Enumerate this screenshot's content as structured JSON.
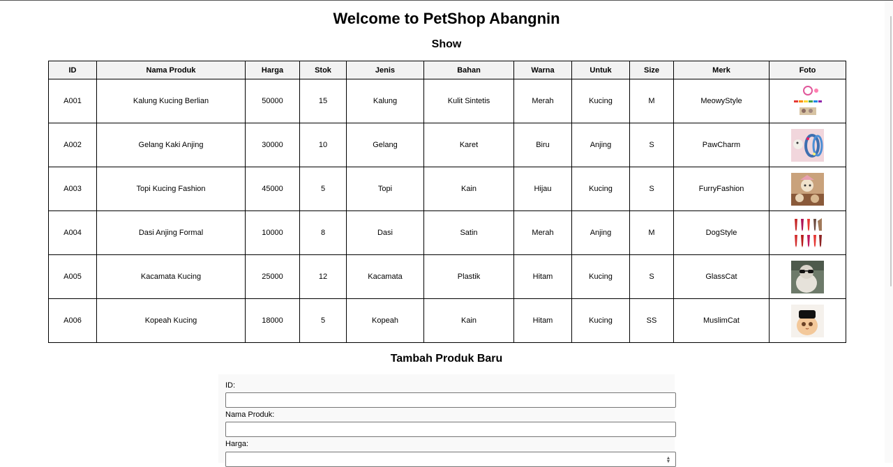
{
  "page": {
    "title": "Welcome to PetShop Abangnin",
    "show_heading": "Show",
    "add_heading": "Tambah Produk Baru"
  },
  "table": {
    "headers": [
      "ID",
      "Nama Produk",
      "Harga",
      "Stok",
      "Jenis",
      "Bahan",
      "Warna",
      "Untuk",
      "Size",
      "Merk",
      "Foto"
    ],
    "rows": [
      {
        "id": "A001",
        "nama": "Kalung Kucing Berlian",
        "harga": "50000",
        "stok": "15",
        "jenis": "Kalung",
        "bahan": "Kulit Sintetis",
        "warna": "Merah",
        "untuk": "Kucing",
        "size": "M",
        "merk": "MeowyStyle",
        "foto": "pet-collar-photo"
      },
      {
        "id": "A002",
        "nama": "Gelang Kaki Anjing",
        "harga": "30000",
        "stok": "10",
        "jenis": "Gelang",
        "bahan": "Karet",
        "warna": "Biru",
        "untuk": "Anjing",
        "size": "S",
        "merk": "PawCharm",
        "foto": "pet-bracelet-photo"
      },
      {
        "id": "A003",
        "nama": "Topi Kucing Fashion",
        "harga": "45000",
        "stok": "5",
        "jenis": "Topi",
        "bahan": "Kain",
        "warna": "Hijau",
        "untuk": "Kucing",
        "size": "S",
        "merk": "FurryFashion",
        "foto": "cat-hat-photo"
      },
      {
        "id": "A004",
        "nama": "Dasi Anjing Formal",
        "harga": "10000",
        "stok": "8",
        "jenis": "Dasi",
        "bahan": "Satin",
        "warna": "Merah",
        "untuk": "Anjing",
        "size": "M",
        "merk": "DogStyle",
        "foto": "dog-tie-photo"
      },
      {
        "id": "A005",
        "nama": "Kacamata Kucing",
        "harga": "25000",
        "stok": "12",
        "jenis": "Kacamata",
        "bahan": "Plastik",
        "warna": "Hitam",
        "untuk": "Kucing",
        "size": "S",
        "merk": "GlassCat",
        "foto": "cat-glasses-photo"
      },
      {
        "id": "A006",
        "nama": "Kopeah Kucing",
        "harga": "18000",
        "stok": "5",
        "jenis": "Kopeah",
        "bahan": "Kain",
        "warna": "Hitam",
        "untuk": "Kucing",
        "size": "SS",
        "merk": "MuslimCat",
        "foto": "cat-kopeah-photo"
      }
    ]
  },
  "form": {
    "id_label": "ID:",
    "id_value": "",
    "nama_label": "Nama Produk:",
    "nama_value": "",
    "harga_label": "Harga:",
    "harga_value": ""
  },
  "colors": {
    "header_bg": "#f2f2f2",
    "border": "#000000",
    "form_bg": "#f9f9f9"
  }
}
